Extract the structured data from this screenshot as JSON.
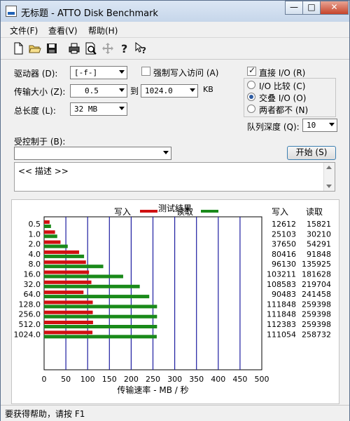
{
  "window": {
    "title": "无标题 - ATTO Disk Benchmark",
    "buttons": {
      "minimize": "—",
      "maximize": "□",
      "close": "✕"
    }
  },
  "menu": [
    "文件(F)",
    "查看(V)",
    "帮助(H)"
  ],
  "toolbar": [
    "new-file-icon",
    "open-folder-icon",
    "save-icon",
    "print-icon",
    "print-preview-icon",
    "move-icon",
    "help-icon",
    "context-help-icon"
  ],
  "settings": {
    "drive_label": "驱动器 (D):",
    "drive_value": "[-f-]",
    "transfer_label": "传输大小 (Z):",
    "transfer_from": "0.5",
    "to_label": "到",
    "transfer_to": "1024.0",
    "kb_unit": "KB",
    "length_label": "总长度 (L):",
    "length_value": "32 MB",
    "force_write_label": "强制写入访问 (A)",
    "force_write_checked": false,
    "direct_io_label": "直接 I/O (R)",
    "direct_io_checked": true,
    "io_options": [
      {
        "label": "I/O 比较 (C)",
        "selected": false
      },
      {
        "label": "交叠 I/O (O)",
        "selected": true
      },
      {
        "label": "两者都不 (N)",
        "selected": false
      }
    ],
    "queue_label": "队列深度 (Q):",
    "queue_value": "10",
    "controlled_label": "受控制于 (B):",
    "controlled_value": "",
    "start_button": "开始 (S)",
    "description": "<< 描述 >>"
  },
  "results": {
    "title": "测试结果",
    "write_label": "写入",
    "read_label": "读取",
    "col_write": "写入",
    "col_read": "读取",
    "write_color": "#d01010",
    "read_color": "#1a8a1a",
    "grid_color": "#1c1ca0"
  },
  "chart_data": {
    "type": "bar",
    "orientation": "horizontal",
    "title": "测试结果",
    "xlabel": "传输速率 - MB / 秒",
    "xlim": [
      0,
      500
    ],
    "xticks": [
      0,
      50,
      100,
      150,
      200,
      250,
      300,
      350,
      400,
      450,
      500
    ],
    "categories": [
      "0.5",
      "1.0",
      "2.0",
      "4.0",
      "8.0",
      "16.0",
      "32.0",
      "64.0",
      "128.0",
      "256.0",
      "512.0",
      "1024.0"
    ],
    "series": [
      {
        "name": "写入",
        "values": [
          12.6,
          25.1,
          37.7,
          80.4,
          96.1,
          103.2,
          108.6,
          90.5,
          111.8,
          111.8,
          112.4,
          111.1
        ]
      },
      {
        "name": "读取",
        "values": [
          15.8,
          30.2,
          54.3,
          91.8,
          135.9,
          181.6,
          219.7,
          241.5,
          259.4,
          259.4,
          259.4,
          258.7
        ]
      }
    ],
    "table": [
      {
        "write": "12612",
        "read": "15821"
      },
      {
        "write": "25103",
        "read": "30210"
      },
      {
        "write": "37650",
        "read": "54291"
      },
      {
        "write": "80416",
        "read": "91848"
      },
      {
        "write": "96130",
        "read": "135925"
      },
      {
        "write": "103211",
        "read": "181628"
      },
      {
        "write": "108583",
        "read": "219704"
      },
      {
        "write": "90483",
        "read": "241458"
      },
      {
        "write": "111848",
        "read": "259398"
      },
      {
        "write": "111848",
        "read": "259398"
      },
      {
        "write": "112383",
        "read": "259398"
      },
      {
        "write": "111054",
        "read": "258732"
      }
    ]
  },
  "status": "要获得帮助，请按 F1"
}
